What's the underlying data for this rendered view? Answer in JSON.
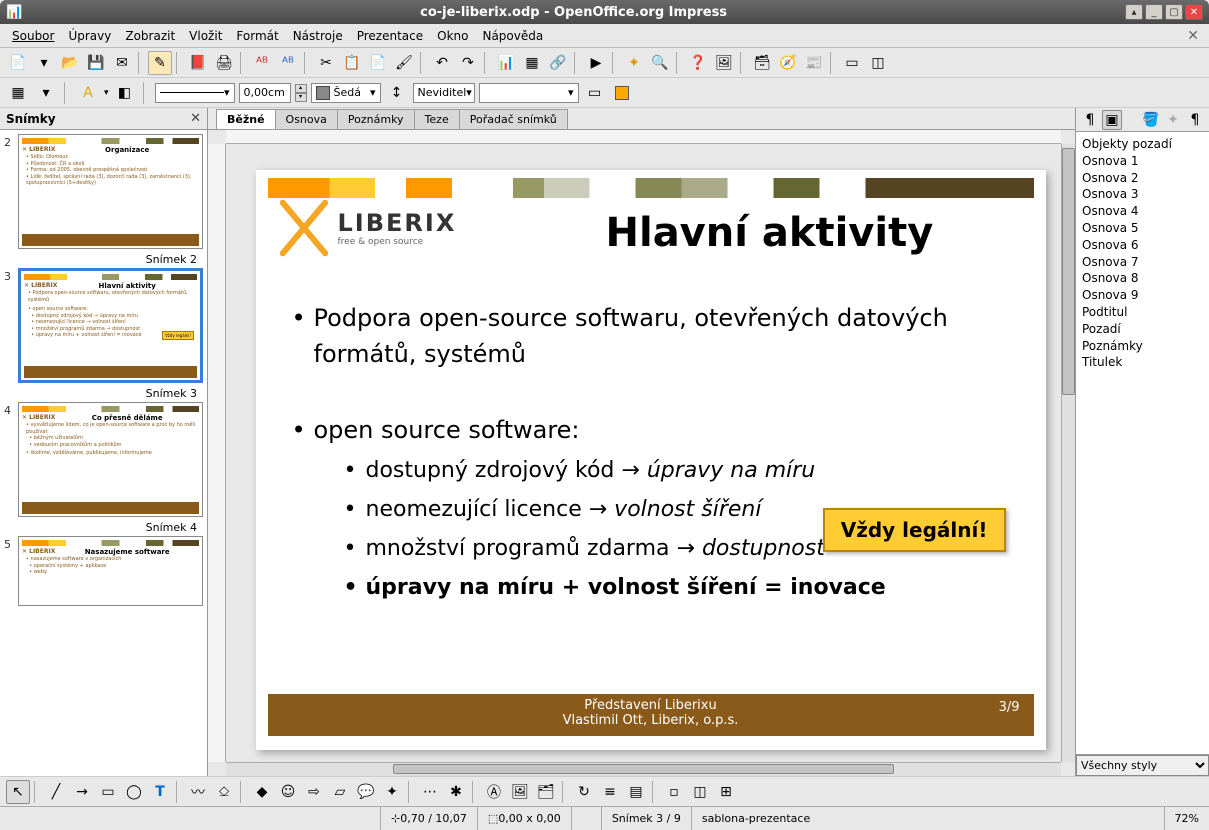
{
  "window": {
    "title": "co-je-liberix.odp - OpenOffice.org Impress"
  },
  "menubar": {
    "items": [
      "Soubor",
      "Úpravy",
      "Zobrazit",
      "Vložit",
      "Formát",
      "Nástroje",
      "Prezentace",
      "Okno",
      "Nápověda"
    ]
  },
  "toolbar2": {
    "linewidth": "0,00cm",
    "color_name": "Šedá",
    "arrow_style": "Neviditel"
  },
  "slidepanel": {
    "title": "Snímky",
    "labels": [
      "Snímek 2",
      "Snímek 3",
      "Snímek 4"
    ],
    "thumb_titles": [
      "Organizace",
      "Hlavní aktivity",
      "Co přesně děláme",
      "Nasazujeme software"
    ]
  },
  "viewtabs": [
    "Běžné",
    "Osnova",
    "Poznámky",
    "Teze",
    "Pořadač snímků"
  ],
  "slide": {
    "logo_main": "LIBERIX",
    "logo_sub": "free & open source",
    "title": "Hlavní aktivity",
    "bullet1": "Podpora open-source softwaru, otevřených datových formátů, systémů",
    "bullet2": "open source software:",
    "sub1_a": "dostupný zdrojový kód → ",
    "sub1_b": "úpravy na míru",
    "sub2_a": "neomezující licence → ",
    "sub2_b": "volnost šíření",
    "sub3_a": "množství programů zdarma → ",
    "sub3_b": "dostupnost",
    "sub4": "úpravy na míru + volnost šíření = inovace",
    "callout": "Vždy legální!",
    "footer1": "Představení Liberixu",
    "footer2": "Vlastimil Ott, Liberix, o.p.s.",
    "footer_page": "3/9"
  },
  "rightpanel": {
    "header": "Objekty pozadí",
    "items": [
      "Osnova 1",
      "Osnova 2",
      "Osnova 3",
      "Osnova 4",
      "Osnova 5",
      "Osnova 6",
      "Osnova 7",
      "Osnova 8",
      "Osnova 9",
      "Podtitul",
      "Pozadí",
      "Poznámky",
      "Titulek"
    ],
    "dropdown": "Všechny styly"
  },
  "statusbar": {
    "pos": "0,70 / 10,07",
    "size": "0,00 x 0,00",
    "slide": "Snímek 3 / 9",
    "template": "sablona-prezentace",
    "zoom": "72%"
  }
}
